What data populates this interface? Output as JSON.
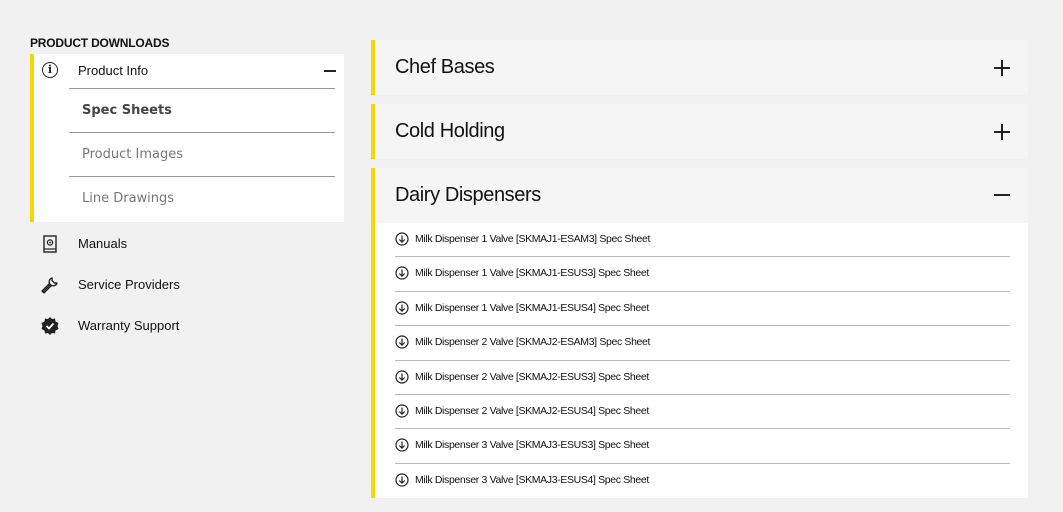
{
  "sidebar": {
    "heading": "PRODUCT DOWNLOADS",
    "active_section": {
      "label": "Product Info",
      "icon": "info-icon",
      "sub_items": [
        {
          "label": "Spec Sheets",
          "active": true
        },
        {
          "label": "Product Images",
          "active": false
        },
        {
          "label": "Line Drawings",
          "active": false
        }
      ]
    },
    "items": [
      {
        "label": "Manuals",
        "icon": "manual-icon"
      },
      {
        "label": "Service Providers",
        "icon": "wrench-icon"
      },
      {
        "label": "Warranty Support",
        "icon": "shield-check-icon"
      }
    ]
  },
  "accordions": [
    {
      "title": "Chef Bases",
      "expanded": false
    },
    {
      "title": "Cold Holding",
      "expanded": false
    },
    {
      "title": "Dairy Dispensers",
      "expanded": true,
      "downloads": [
        "Milk Dispenser 1 Valve [SKMAJ1-ESAM3] Spec Sheet",
        "Milk Dispenser 1 Valve [SKMAJ1-ESUS3] Spec Sheet",
        "Milk Dispenser 1 Valve [SKMAJ1-ESUS4] Spec Sheet",
        "Milk Dispenser 2 Valve [SKMAJ2-ESAM3] Spec Sheet",
        "Milk Dispenser 2 Valve [SKMAJ2-ESUS3] Spec Sheet",
        "Milk Dispenser 2 Valve [SKMAJ2-ESUS4] Spec Sheet",
        "Milk Dispenser 3 Valve [SKMAJ3-ESUS3] Spec Sheet",
        "Milk Dispenser 3 Valve [SKMAJ3-ESUS4] Spec Sheet"
      ]
    }
  ],
  "colors": {
    "accent": "#f5d800",
    "background": "#f1f1f1"
  }
}
